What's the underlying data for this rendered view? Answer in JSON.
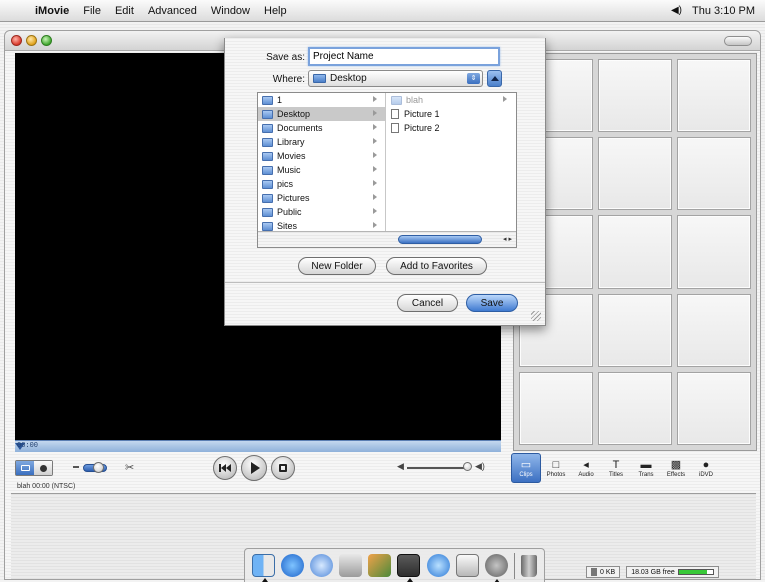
{
  "menubar": {
    "app": "iMovie",
    "items": [
      "File",
      "Edit",
      "Advanced",
      "Window",
      "Help"
    ],
    "clock": "Thu 3:10 PM"
  },
  "save_sheet": {
    "save_as_label": "Save as:",
    "project_name": "Project Name",
    "where_label": "Where:",
    "where_value": "Desktop",
    "column1": [
      "1",
      "Desktop",
      "Documents",
      "Library",
      "Movies",
      "Music",
      "pics",
      "Pictures",
      "Public",
      "Sites"
    ],
    "selected": "Desktop",
    "column2": [
      "blah",
      "Picture 1",
      "Picture 2"
    ],
    "new_folder": "New Folder",
    "add_to_favorites": "Add to Favorites",
    "cancel": "Cancel",
    "save": "Save"
  },
  "controls": {
    "panes": [
      {
        "label": "Clips",
        "icon": "clips-icon",
        "glyph": "▭"
      },
      {
        "label": "Photos",
        "icon": "photos-icon",
        "glyph": "□"
      },
      {
        "label": "Audio",
        "icon": "audio-icon",
        "glyph": "◂"
      },
      {
        "label": "Titles",
        "icon": "titles-icon",
        "glyph": "T"
      },
      {
        "label": "Trans",
        "icon": "transitions-icon",
        "glyph": "▬"
      },
      {
        "label": "Effects",
        "icon": "effects-icon",
        "glyph": "▩"
      },
      {
        "label": "iDVD",
        "icon": "idvd-icon",
        "glyph": "●"
      }
    ],
    "clip_info": "blah 00:00 (NTSC)",
    "scrubber_time": "00:00"
  },
  "status": {
    "trash": "0 KB",
    "free": "18.03 GB free",
    "free_fraction": 0.82
  },
  "colors": {
    "accent": "#3a6fbf",
    "monitor": "#000000"
  }
}
